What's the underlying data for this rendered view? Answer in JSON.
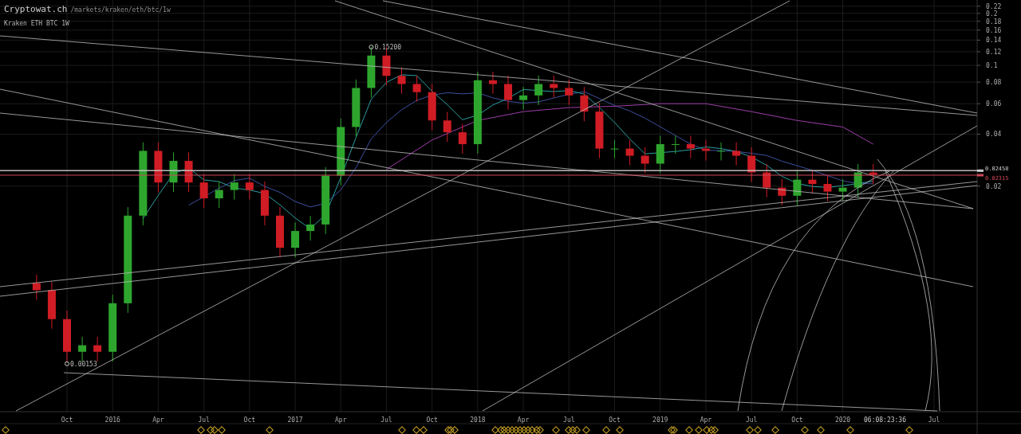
{
  "header": {
    "site": "Cryptowat.ch",
    "path": "/markets/kraken/eth/btc/1w",
    "subtitle": "Kraken ETH BTC 1W"
  },
  "chart": {
    "time_axis": [
      "Oct",
      "2016",
      "Apr",
      "Jul",
      "Oct",
      "2017",
      "Apr",
      "Jul",
      "Oct",
      "2018",
      "Apr",
      "Jul",
      "Oct",
      "2019",
      "Apr",
      "Jul",
      "Oct",
      "2020",
      "Jul"
    ],
    "price_axis": [
      "0.22",
      "0.2",
      "0.18",
      "0.16",
      "0.14",
      "0.12",
      "0.1",
      "0.08",
      "0.06",
      "0.04",
      "0.02"
    ],
    "annotations": [
      "0.15200",
      "0.00153"
    ],
    "price_labels": [
      {
        "text": "0.02458",
        "color": "#cccccc"
      },
      {
        "text": "0.02315",
        "color": "#d0485a"
      }
    ],
    "countdown": "06:08:23:36"
  }
}
